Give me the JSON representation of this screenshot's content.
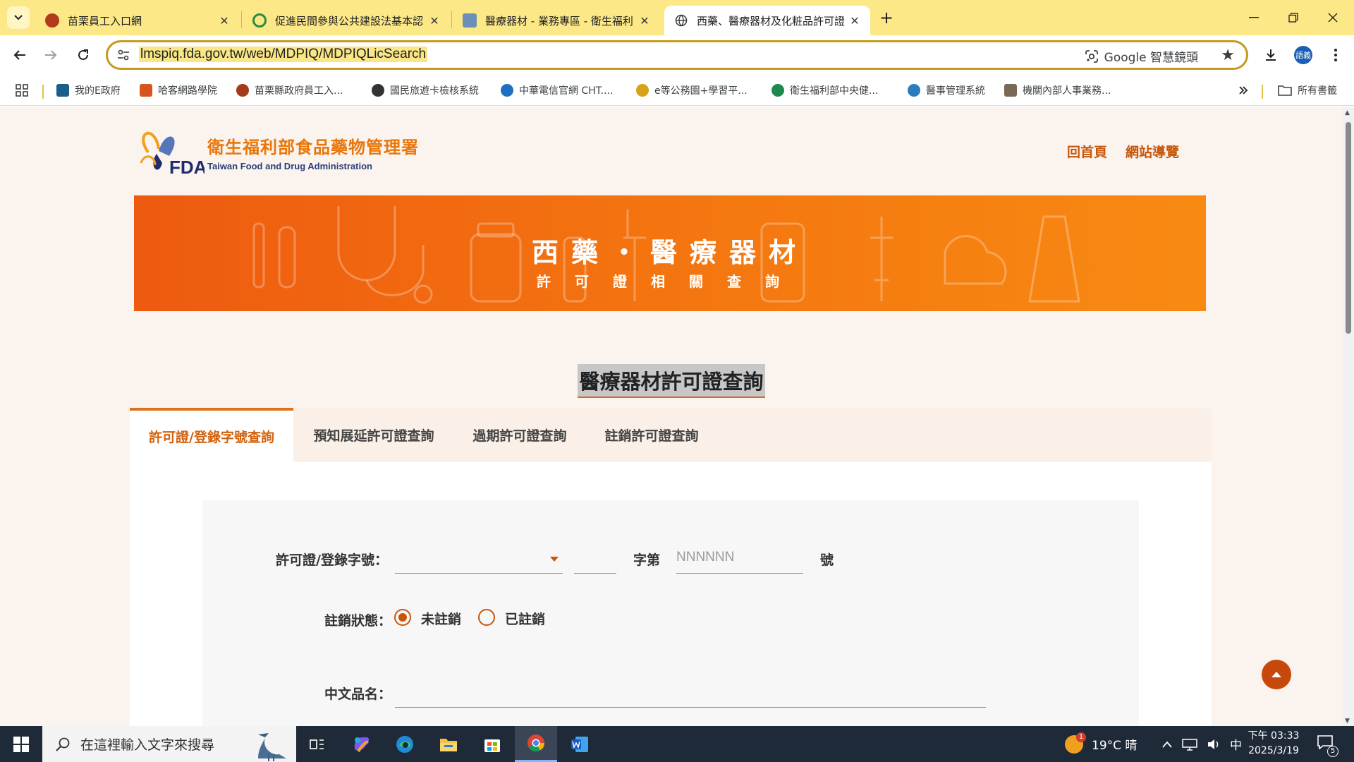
{
  "browser": {
    "tabs": [
      {
        "title": "苗栗員工入口網",
        "active": false
      },
      {
        "title": "促進民間參與公共建設法基本認",
        "active": false
      },
      {
        "title": "醫療器材 - 業務專區 - 衛生福利",
        "active": false
      },
      {
        "title": "西藥、醫療器材及化粧品許可證",
        "active": true
      }
    ],
    "url": "lmspiq.fda.gov.tw/web/MDPIQ/MDPIQLicSearch",
    "lens_label": "Google 智慧鏡頭",
    "profile_initials": "語義",
    "bookmarks": [
      {
        "label": "我的E政府",
        "color": "#1b5e8a"
      },
      {
        "label": "哈客網路學院",
        "color": "#d9541c"
      },
      {
        "label": "苗栗縣政府員工入...",
        "color": "#a33a1a"
      },
      {
        "label": "國民旅遊卡檢核系統",
        "color": "#333333"
      },
      {
        "label": "中華電信官網 CHT....",
        "color": "#1d6fc2"
      },
      {
        "label": "e等公務園+學習平...",
        "color": "#d7a21a"
      },
      {
        "label": "衛生福利部中央健...",
        "color": "#1d8a4d"
      },
      {
        "label": "醫事管理系統",
        "color": "#2b7bbf"
      },
      {
        "label": "機關內部人事業務...",
        "color": "#7a6a55"
      }
    ],
    "all_bookmarks_label": "所有書籤"
  },
  "site": {
    "org_name_zh": "衛生福利部食品藥物管理署",
    "org_name_en": "Taiwan Food and Drug Administration",
    "logo_text": "FDA",
    "nav_links": [
      "回首頁",
      "網站導覽"
    ],
    "banner_title": "西藥・醫療器材",
    "banner_subtitle": "許可證相關查詢",
    "page_title": "醫療器材許可證查詢",
    "query_tabs": [
      {
        "label": "許可證/登錄字號查詢",
        "active": true
      },
      {
        "label": "預知展延許可證查詢",
        "active": false
      },
      {
        "label": "過期許可證查詢",
        "active": false
      },
      {
        "label": "註銷許可證查詢",
        "active": false
      }
    ],
    "form": {
      "license_label": "許可證/登錄字號：",
      "word_suffix": "字第",
      "number_placeholder": "NNNNNN",
      "number_suffix": "號",
      "cancel_status_label": "註銷狀態：",
      "cancel_options": [
        {
          "label": "未註銷",
          "checked": true
        },
        {
          "label": "已註銷",
          "checked": false
        }
      ],
      "chinese_name_label": "中文品名："
    }
  },
  "taskbar": {
    "search_placeholder": "在這裡輸入文字來搜尋",
    "weather": "19°C  晴",
    "weather_badge": "1",
    "ime": "中",
    "time": "下午 03:33",
    "date": "2025/3/19",
    "notification_count": "5"
  },
  "colors": {
    "accent": "#e0701a",
    "banner_start": "#ee5a10",
    "banner_end": "#f88a12",
    "tabstrip": "#fce886",
    "omnibox_border": "#c59b1c"
  }
}
